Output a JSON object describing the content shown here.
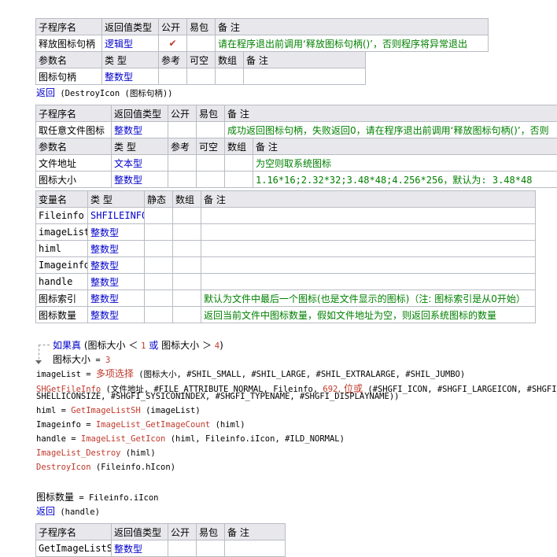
{
  "table1": {
    "header": [
      "子程序名",
      "返回值类型",
      "公开",
      "易包",
      "备 注"
    ],
    "row": {
      "name": "释放图标句柄",
      "type": "逻辑型",
      "public": "✔",
      "pkg": "",
      "note": "请在程序退出前调用‘释放图标句柄()’，否则程序将异常退出"
    },
    "param_header": [
      "参数名",
      "类 型",
      "参考",
      "可空",
      "数组",
      "备 注"
    ],
    "params": [
      {
        "name": "图标句柄",
        "type": "整数型",
        "ref": "",
        "null": "",
        "arr": "",
        "note": ""
      }
    ]
  },
  "return1": {
    "kw": "返回",
    "expr": " (DestroyIcon (图标句柄))"
  },
  "table2": {
    "header": [
      "子程序名",
      "返回值类型",
      "公开",
      "易包",
      "备 注"
    ],
    "row": {
      "name": "取任意文件图标",
      "type": "整数型",
      "public": "",
      "pkg": "",
      "note": "成功返回图标句柄，失败返回0，请在程序退出前调用‘释放图标句柄()’，否则"
    },
    "param_header": [
      "参数名",
      "类 型",
      "参考",
      "可空",
      "数组",
      "备 注"
    ],
    "params": [
      {
        "name": "文件地址",
        "type": "文本型",
        "ref": "",
        "null": "",
        "arr": "",
        "note": "为空则取系统图标"
      },
      {
        "name": "图标大小",
        "type": "整数型",
        "ref": "",
        "null": "",
        "arr": "",
        "note": "1.16*16;2.32*32;3.48*48;4.256*256，默认为: 3.48*48"
      }
    ]
  },
  "vars": {
    "header": [
      "变量名",
      "类 型",
      "静态",
      "数组",
      "备 注"
    ],
    "rows": [
      {
        "name": "Fileinfo",
        "type": "SHFILEINFO",
        "note": ""
      },
      {
        "name": "imageList",
        "type": "整数型",
        "note": ""
      },
      {
        "name": "himl",
        "type": "整数型",
        "note": ""
      },
      {
        "name": "Imageinfo",
        "type": "整数型",
        "note": ""
      },
      {
        "name": "handle",
        "type": "整数型",
        "note": ""
      },
      {
        "name": "图标索引",
        "type": "整数型",
        "note": "默认为文件中最后一个图标(也是文件显示的图标)（注: 图标索引是从0开始）"
      },
      {
        "name": "图标数量",
        "type": "整数型",
        "note": "返回当前文件中图标数量，假如文件地址为空，则返回系统图标的数量"
      }
    ]
  },
  "code": {
    "if_kw": "如果真",
    "if_expr_a": " (图标大小 ＜ ",
    "if_num1": "1",
    "if_or": " 或 ",
    "if_expr_b": "图标大小 ＞ ",
    "if_num2": "4",
    "if_close": ")",
    "assign_var": "图标大小",
    "assign_eq": " = ",
    "assign_val": "3",
    "l1_var": "imageList = ",
    "l1_fn": "多项选择",
    "l1_rest": " (图标大小, #SHIL_SMALL, #SHIL_LARGE, #SHIL_EXTRALARGE, #SHIL_JUMBO)",
    "l2_fn": "SHGetFileInfo",
    "l2_rest": " (文件地址, #FILE_ATTRIBUTE_NORMAL, Fileinfo, ",
    "l2_num": "692",
    "l2_or": ", 位或",
    "l2_rest2": " (#SHGFI_ICON, #SHGFI_LARGEICON, #SHGFI_",
    "l2_cont": "SHELLICONSIZE, #SHGFI_SYSICONINDEX, #SHGFI_TYPENAME, #SHGFI_DISPLAYNAME))",
    "l3_var": "himl = ",
    "l3_fn": "GetImageListSH",
    "l3_rest": " (imageList)",
    "l4_var": "Imageinfo = ",
    "l4_fn": "ImageList_GetImageCount",
    "l4_rest": " (himl)",
    "l5_var": "handle = ",
    "l5_fn": "ImageList_GetIcon",
    "l5_rest": " (himl, Fileinfo.iIcon, #ILD_NORMAL)",
    "l6_fn": "ImageList_Destroy",
    "l6_rest": " (himl)",
    "l7_fn": "DestroyIcon",
    "l7_rest": " (Fileinfo.hIcon)",
    "l8_var": "图标数量",
    "l8_rest": " = Fileinfo.iIcon",
    "l9_kw": "返回",
    "l9_rest": " (handle)"
  },
  "table3": {
    "header": [
      "子程序名",
      "返回值类型",
      "公开",
      "易包",
      "备 注"
    ],
    "row": {
      "name": "GetImageListSH",
      "type": "整数型",
      "public": "",
      "pkg": "",
      "note": ""
    }
  },
  "colors": {
    "keyword": "#0000cc",
    "function": "#c0392b",
    "comment": "#008000",
    "header_bg": "#e8e8ec",
    "border": "#b8bcc4"
  }
}
